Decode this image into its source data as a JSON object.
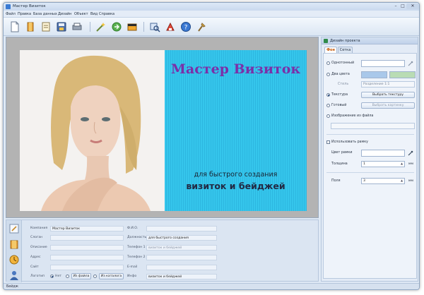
{
  "window": {
    "title": "Мастер Визиток"
  },
  "menu": [
    "Файл",
    "Правка",
    "База данных",
    "Дизайн",
    "Объект",
    "Вид",
    "Справка"
  ],
  "toolbar": {
    "icons": [
      "new-document-icon",
      "open-folder-icon",
      "templates-icon",
      "save-icon",
      "print-icon",
      "wizard-icon",
      "export-icon",
      "image-icon",
      "search-icon",
      "web-icon",
      "help-icon",
      "tools-icon"
    ]
  },
  "card": {
    "title": "Мастер Визиток",
    "subtitle1": "для быстрого создания",
    "subtitle2": "визиток и бейджей",
    "background_color": "#35c6ec",
    "title_color": "#7b2fa8"
  },
  "fields": {
    "company_label": "Компания",
    "company_value": "Мастер Визиток",
    "slogan_label": "Слоган",
    "slogan_value": "",
    "description_label": "Описание",
    "description_value": "",
    "address_label": "Адрес",
    "address_value": "",
    "site_label": "Сайт",
    "site_value": "",
    "logo_label": "Логотип",
    "logo_none": "Нет",
    "logo_file": "Из файла",
    "logo_catalog": "Из каталога",
    "fio_label": "Ф.И.О.",
    "fio_value": "",
    "position_label": "Должность",
    "position_value": "для быстрого создания",
    "phone1_label": "Телефон 1",
    "phone1_value": "визиток и бейджей",
    "phone2_label": "Телефон 2",
    "phone2_value": "",
    "email_label": "E-mail",
    "email_value": "",
    "info_label": "Инфо",
    "info_value": "визиток и бейджей"
  },
  "design_panel": {
    "title": "Дизайн проекта",
    "tab_background": "Фон",
    "tab_grid": "Сетка",
    "solid": "Однотонный",
    "two_colors": "Два цвета",
    "style_label": "Стиль",
    "style_value": "Разделение 1:1",
    "texture": "Текстура",
    "choose_texture": "Выбрать текстуру",
    "ready": "Готовый",
    "choose_picture": "Выбрать картинку",
    "image_from_file": "Изображение из файла",
    "use_frame": "Использовать рамку",
    "frame_color": "Цвет рамки",
    "thickness_label": "Толщина",
    "thickness_value": "1",
    "margins_label": "Поля",
    "margins_value": "3",
    "unit_mm": "мм",
    "swatch1": "#a9c8ea",
    "swatch2": "#b9dcb4"
  },
  "status": {
    "text": "Бейдж"
  }
}
